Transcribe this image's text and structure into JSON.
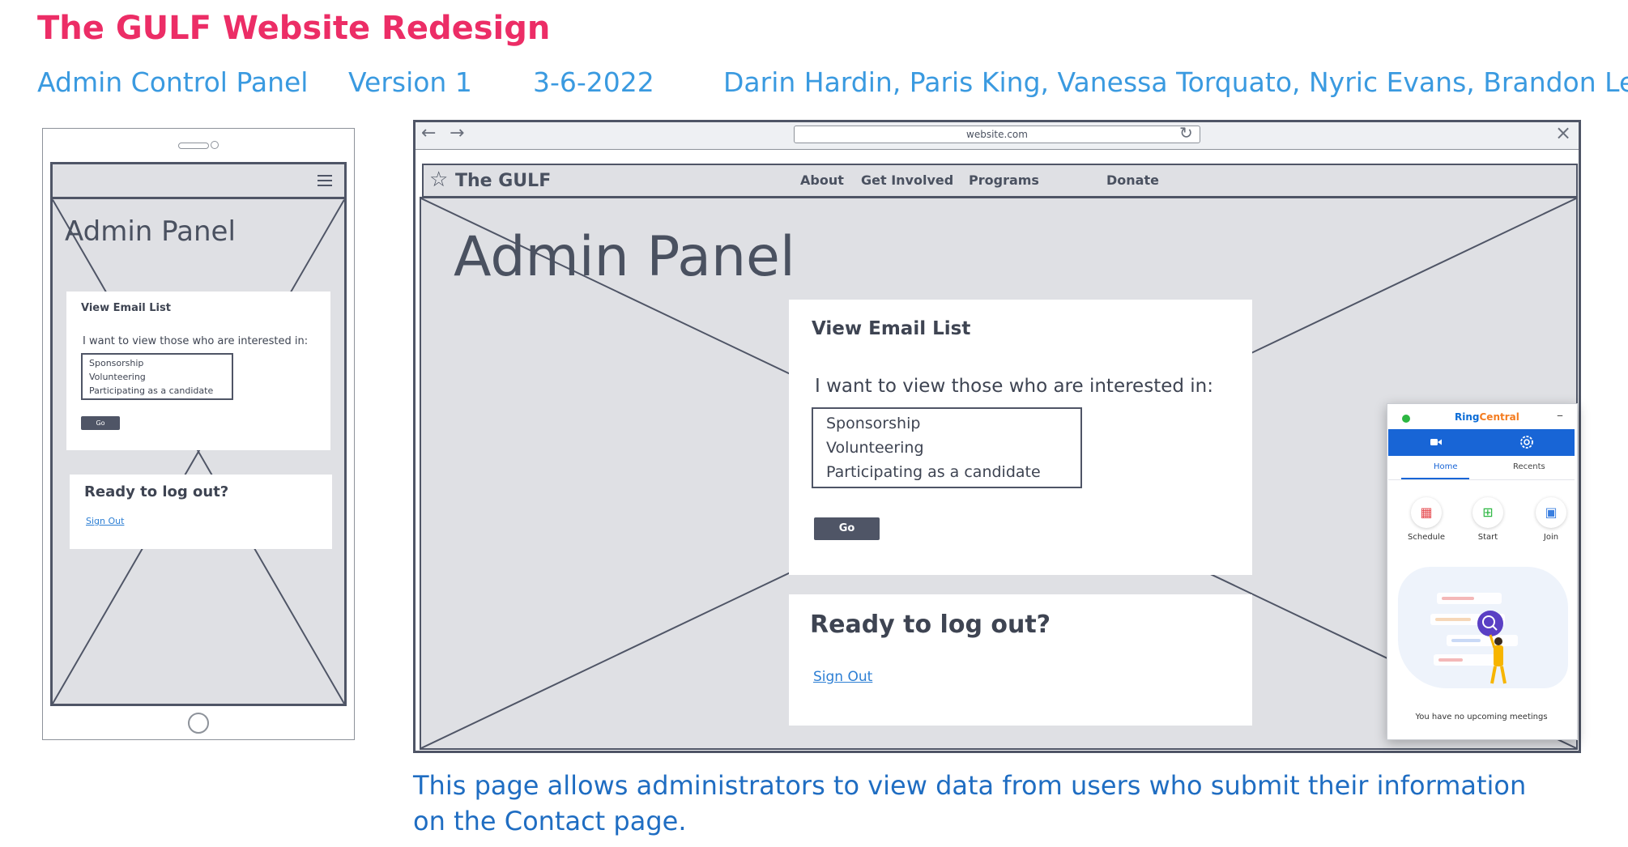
{
  "header": {
    "title": "The GULF Website Redesign",
    "page_name": "Admin Control Panel",
    "version": "Version 1",
    "date": "3-6-2022",
    "authors": "Darin Hardin, Paris King, Vanessa Torquato, Nyric Evans, Brandon Le"
  },
  "mobile": {
    "title": "Admin Panel",
    "email_card": {
      "title": "View Email List",
      "prompt": "I want to view those who are interested in:",
      "options": [
        "Sponsorship",
        "Volunteering",
        "Participating as a candidate"
      ],
      "go_label": "Go"
    },
    "logout_card": {
      "title": "Ready to log out?",
      "signout_label": "Sign Out"
    }
  },
  "desktop": {
    "url": "website.com",
    "site_name": "The GULF",
    "nav": {
      "about": "About",
      "get_involved": "Get Involved",
      "programs": "Programs",
      "donate": "Donate"
    },
    "title": "Admin Panel",
    "email_card": {
      "title": "View Email List",
      "prompt": "I want to view those who are interested in:",
      "options": [
        "Sponsorship",
        "Volunteering",
        "Participating as a candidate"
      ],
      "go_label": "Go"
    },
    "logout_card": {
      "title": "Ready to log out?",
      "signout_label": "Sign Out"
    }
  },
  "ringcentral": {
    "logo_ring": "Ring",
    "logo_central": "Central",
    "tabs": [
      "Home",
      "Recents"
    ],
    "actions": [
      "Schedule",
      "Start",
      "Join"
    ],
    "empty_message": "You have no upcoming meetings"
  },
  "caption": "This page allows administrators to view data from users who submit their information on the Contact page.",
  "colors": {
    "title_pink": "#ec2d66",
    "meta_blue": "#3a9ae0",
    "caption_blue": "#1f6dc2",
    "wireframe_dark": "#4f5566",
    "placeholder_gray": "#dfe0e4",
    "ringcentral_blue": "#1865d6"
  }
}
